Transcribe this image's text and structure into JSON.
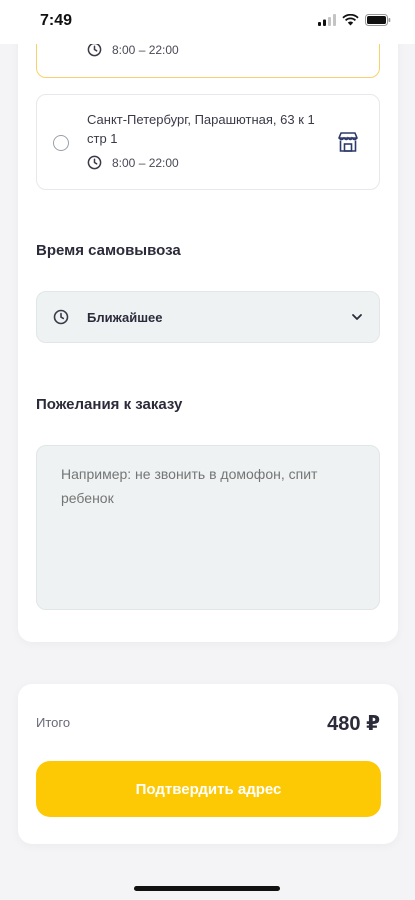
{
  "status_bar": {
    "time": "7:49"
  },
  "stores": [
    {
      "hours": "8:00 – 22:00",
      "selected": true
    },
    {
      "address": "Санкт-Петербург, Парашютная, 63 к 1 стр 1",
      "hours": "8:00 – 22:00",
      "selected": false
    }
  ],
  "pickup_time": {
    "title": "Время самовывоза",
    "value": "Ближайшее"
  },
  "order_wishes": {
    "title": "Пожелания к заказу",
    "placeholder": "Например: не звонить в домофон, спит ребенок"
  },
  "summary": {
    "total_label": "Итого",
    "total_value": "480 ₽",
    "confirm_label": "Подтвердить адрес"
  },
  "colors": {
    "accent": "#fdc905",
    "selected_border": "#f6d36a",
    "input_bg": "#eef2f3"
  }
}
